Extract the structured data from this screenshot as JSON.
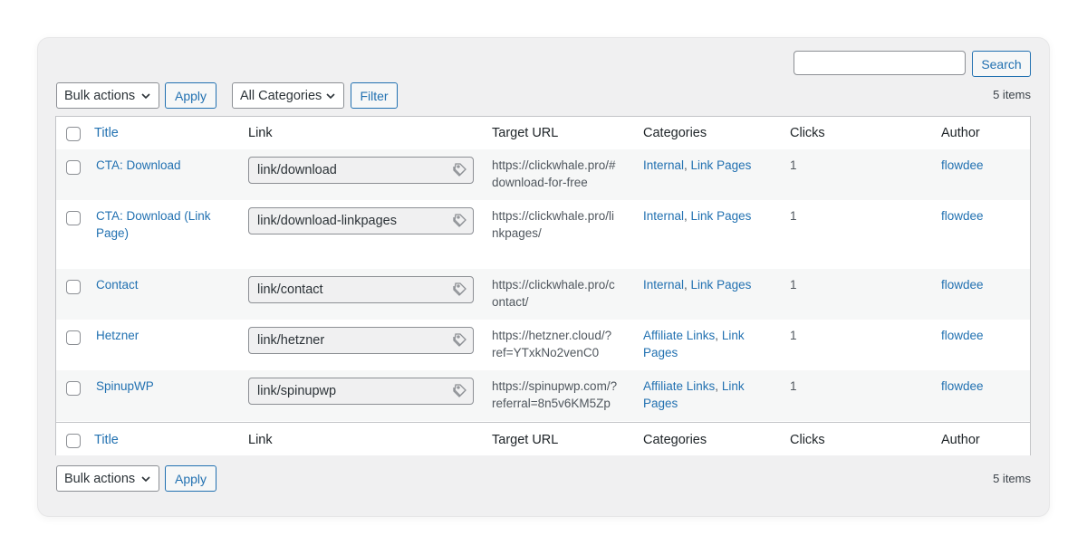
{
  "toolbar_top": {
    "search_value": "",
    "search_button": "Search",
    "bulk_actions": "Bulk actions",
    "apply": "Apply",
    "categories": "All Categories",
    "filter": "Filter",
    "items_count": "5 items"
  },
  "table": {
    "columns": {
      "title": "Title",
      "link": "Link",
      "target_url": "Target URL",
      "categories": "Categories",
      "clicks": "Clicks",
      "author": "Author"
    },
    "rows": [
      {
        "title_lines": [
          "CTA: Download"
        ],
        "link": "link/download",
        "url_lines": [
          "https://clickwhale.pro/#",
          "download-for-free"
        ],
        "categories": [
          [
            "Internal",
            "Link Pages"
          ]
        ],
        "clicks": "1",
        "author": "flowdee"
      },
      {
        "title_lines": [
          "CTA: Download (Link",
          "Page)"
        ],
        "link": "link/download-linkpages",
        "url_lines": [
          "https://clickwhale.pro/li",
          "nkpages/"
        ],
        "categories": [
          [
            "Internal",
            "Link Pages"
          ]
        ],
        "clicks": "1",
        "author": "flowdee"
      },
      {
        "title_lines": [
          "Contact"
        ],
        "link": "link/contact",
        "url_lines": [
          "https://clickwhale.pro/c",
          "ontact/"
        ],
        "categories": [
          [
            "Internal",
            "Link Pages"
          ]
        ],
        "clicks": "1",
        "author": "flowdee"
      },
      {
        "title_lines": [
          "Hetzner"
        ],
        "link": "link/hetzner",
        "url_lines": [
          "https://hetzner.cloud/?",
          "ref=YTxkNo2venC0"
        ],
        "categories": [
          [
            "Affiliate Links",
            "Link"
          ],
          [
            "Pages"
          ]
        ],
        "clicks": "1",
        "author": "flowdee"
      },
      {
        "title_lines": [
          "SpinupWP"
        ],
        "link": "link/spinupwp",
        "url_lines": [
          "https://spinupwp.com/?",
          "referral=8n5v6KM5Zp"
        ],
        "categories": [
          [
            "Affiliate Links",
            "Link"
          ],
          [
            "Pages"
          ]
        ],
        "clicks": "1",
        "author": "flowdee"
      }
    ]
  },
  "toolbar_bottom": {
    "bulk_actions": "Bulk actions",
    "apply": "Apply",
    "items_count": "5 items"
  },
  "colors": {
    "accent": "#2271b1",
    "panel_bg": "#f0f0f1",
    "row_alt": "#f6f7f7",
    "border": "#c3c4c7"
  },
  "icons": {
    "select_chevron": "chevron-down-icon",
    "link_copy": "copy-tag-icon"
  }
}
